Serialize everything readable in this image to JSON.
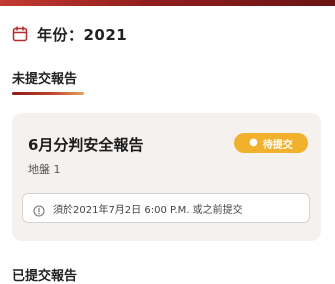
{
  "header": {
    "year_label": "年份：2021",
    "calendar_icon": "calendar-icon",
    "accent": "#b52c2c"
  },
  "pending": {
    "title": "未提交報告",
    "card": {
      "title": "6月分判安全報告",
      "subtitle": "地盤 1",
      "badge_label": "待提交",
      "badge_color": "#f2b12c",
      "deadline_icon": "info-icon",
      "deadline_text": "須於2021年7月2日 6:00 P.M. 或之前提交"
    }
  },
  "submitted": {
    "title": "已提交報告"
  }
}
